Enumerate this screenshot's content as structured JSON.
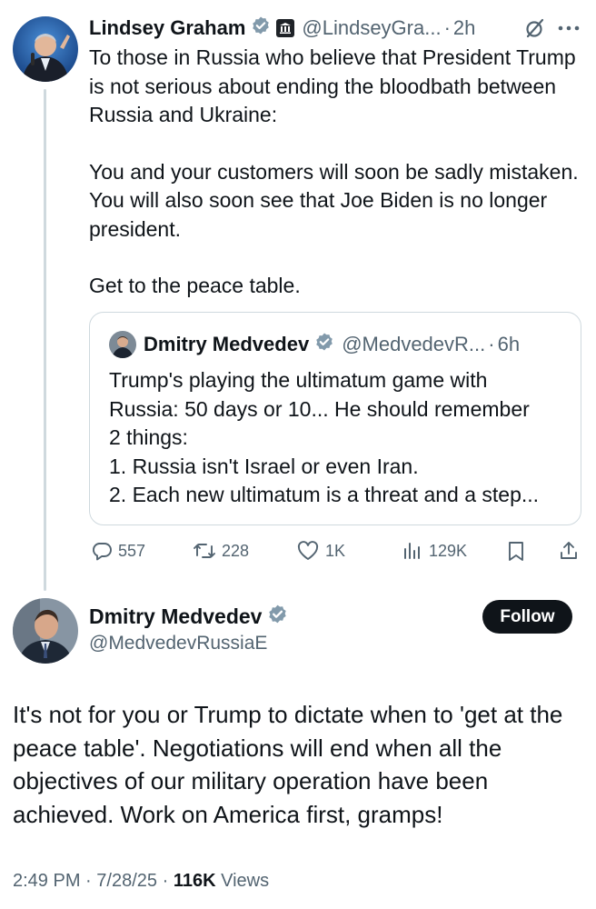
{
  "parent_tweet": {
    "author_name": "Lindsey Graham",
    "handle": "@LindseyGra...",
    "separator": "·",
    "time": "2h",
    "text": [
      "To those in Russia who believe that President Trump is not serious about ending the bloodbath between Russia and Ukraine:",
      "You and your customers will soon be sadly mistaken. You will also soon see that Joe Biden is no longer president.",
      "Get to the peace table."
    ],
    "icons": {
      "verified": "verified-badge-icon",
      "government": "government-building-badge-icon",
      "grok": "grok-icon",
      "more": "more-dots-icon"
    }
  },
  "quoted_tweet": {
    "author_name": "Dmitry Medvedev",
    "handle": "@MedvedevR...",
    "separator": "·",
    "time": "6h",
    "lines": [
      "Trump's playing the ultimatum game with",
      "Russia: 50 days or 10... He should remember",
      "2 things:",
      "1. Russia isn't Israel or even Iran.",
      "2. Each new ultimatum is a threat and a step..."
    ]
  },
  "actions": {
    "replies": "557",
    "reposts": "228",
    "likes": "1K",
    "views": "129K",
    "icons": [
      "reply-icon",
      "repost-icon",
      "like-icon",
      "views-icon",
      "bookmark-icon",
      "share-icon"
    ]
  },
  "reply_tweet": {
    "author_name": "Dmitry Medvedev",
    "handle": "@MedvedevRussiaE",
    "follow_label": "Follow",
    "text": "It's not for you or Trump to dictate when to 'get at the peace table'. Negotiations will end when all the objectives of our military operation have been achieved. Work on America first, gramps!",
    "time": "2:49 PM",
    "separator": "·",
    "date": "7/28/25",
    "views_count": "116K",
    "views_label": "Views"
  },
  "colors": {
    "text": "#0f1419",
    "muted": "#536471",
    "verified_blue": "#1d9bf0",
    "border": "#cfd9de",
    "follow_button_bg": "#0f1419"
  }
}
